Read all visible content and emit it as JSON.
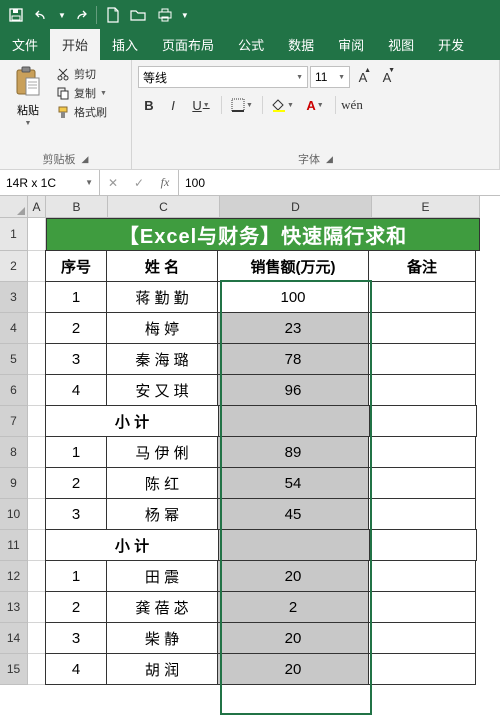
{
  "qat": {
    "save": "save-icon",
    "undo": "undo-icon",
    "redo": "redo-icon",
    "new": "new-icon",
    "open": "open-icon",
    "print": "print-icon"
  },
  "tabs": [
    "文件",
    "开始",
    "插入",
    "页面布局",
    "公式",
    "数据",
    "审阅",
    "视图",
    "开发"
  ],
  "active_tab": 1,
  "ribbon": {
    "clipboard": {
      "paste": "粘贴",
      "cut": "剪切",
      "copy": "复制",
      "painter": "格式刷",
      "group": "剪贴板"
    },
    "font": {
      "group": "字体",
      "name": "等线",
      "size": "11",
      "bold": "B",
      "italic": "I",
      "underline": "U"
    }
  },
  "namebox": "14R x 1C",
  "formula": "100",
  "columns": [
    "A",
    "B",
    "C",
    "D",
    "E"
  ],
  "banner": "【Excel与财务】快速隔行求和",
  "headers": {
    "seq": "序号",
    "name": "姓 名",
    "sales": "销售额(万元)",
    "note": "备注"
  },
  "subtotal": "小 计",
  "rows": [
    {
      "n": 1,
      "seq": "1",
      "name": "蒋 勤 勤",
      "sales": "100",
      "tight": false
    },
    {
      "n": 2,
      "seq": "2",
      "name": "梅   婷",
      "sales": "23",
      "tight": false
    },
    {
      "n": 3,
      "seq": "3",
      "name": "秦 海 璐",
      "sales": "78",
      "tight": false
    },
    {
      "n": 4,
      "seq": "4",
      "name": "安 又 琪",
      "sales": "96",
      "tight": false
    },
    {
      "n": 5,
      "subtotal": true
    },
    {
      "n": 6,
      "seq": "1",
      "name": "马 伊 俐",
      "sales": "89",
      "tight": false
    },
    {
      "n": 7,
      "seq": "2",
      "name": "陈   红",
      "sales": "54",
      "tight": false
    },
    {
      "n": 8,
      "seq": "3",
      "name": "杨   幂",
      "sales": "45",
      "tight": false
    },
    {
      "n": 9,
      "subtotal": true
    },
    {
      "n": 10,
      "seq": "1",
      "name": "田   震",
      "sales": "20",
      "tight": false
    },
    {
      "n": 11,
      "seq": "2",
      "name": "龚 蓓 苾",
      "sales": "2",
      "tight": false
    },
    {
      "n": 12,
      "seq": "3",
      "name": "柴   静",
      "sales": "20",
      "tight": false
    },
    {
      "n": 13,
      "seq": "4",
      "name": "胡   润",
      "sales": "20",
      "tight": false
    }
  ],
  "chart_data": {
    "type": "table",
    "title": "【Excel与财务】快速隔行求和",
    "columns": [
      "序号",
      "姓名",
      "销售额(万元)",
      "备注"
    ],
    "groups": [
      {
        "rows": [
          {
            "序号": 1,
            "姓名": "蒋勤勤",
            "销售额(万元)": 100
          },
          {
            "序号": 2,
            "姓名": "梅婷",
            "销售额(万元)": 23
          },
          {
            "序号": 3,
            "姓名": "秦海璐",
            "销售额(万元)": 78
          },
          {
            "序号": 4,
            "姓名": "安又琪",
            "销售额(万元)": 96
          }
        ],
        "subtotal_label": "小计"
      },
      {
        "rows": [
          {
            "序号": 1,
            "姓名": "马伊俐",
            "销售额(万元)": 89
          },
          {
            "序号": 2,
            "姓名": "陈红",
            "销售额(万元)": 54
          },
          {
            "序号": 3,
            "姓名": "杨幂",
            "销售额(万元)": 45
          }
        ],
        "subtotal_label": "小计"
      },
      {
        "rows": [
          {
            "序号": 1,
            "姓名": "田震",
            "销售额(万元)": 20
          },
          {
            "序号": 2,
            "姓名": "龚蓓苾",
            "销售额(万元)": 2
          },
          {
            "序号": 3,
            "姓名": "柴静",
            "销售额(万元)": 20
          },
          {
            "序号": 4,
            "姓名": "胡润",
            "销售额(万元)": 20
          }
        ],
        "subtotal_label": "小计"
      }
    ]
  }
}
